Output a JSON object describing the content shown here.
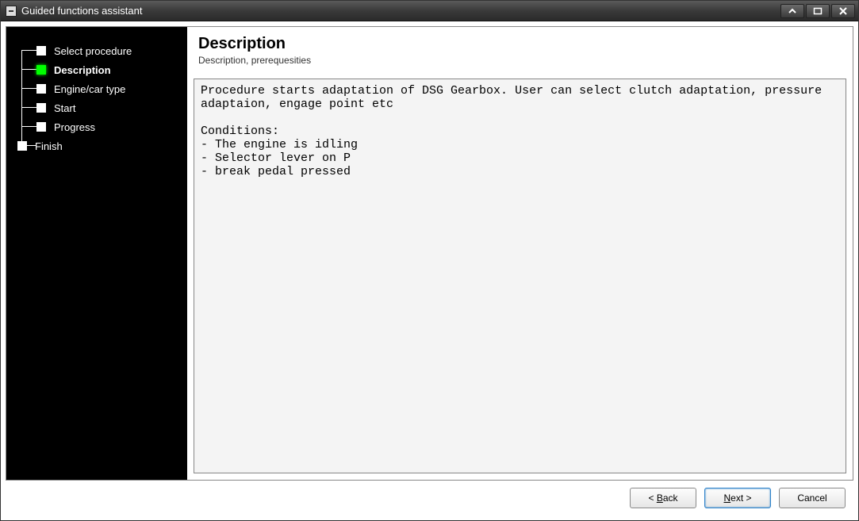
{
  "window": {
    "title": "Guided functions assistant"
  },
  "sidebar": {
    "items": [
      {
        "label": "Select procedure",
        "active": false
      },
      {
        "label": "Description",
        "active": true
      },
      {
        "label": "Engine/car type",
        "active": false
      },
      {
        "label": "Start",
        "active": false
      },
      {
        "label": "Progress",
        "active": false
      },
      {
        "label": "Finish",
        "active": false
      }
    ]
  },
  "main": {
    "title": "Description",
    "subtitle": "Description, prerequesities",
    "body_text": "Procedure starts adaptation of DSG Gearbox. User can select clutch adaptation, pressure adaptaion, engage point etc\n\nConditions:\n- The engine is idling\n- Selector lever on P\n- break pedal pressed"
  },
  "buttons": {
    "back_prefix": "< ",
    "back_hotkey": "B",
    "back_rest": "ack",
    "next_hotkey": "N",
    "next_rest": "ext >",
    "cancel": "Cancel"
  }
}
